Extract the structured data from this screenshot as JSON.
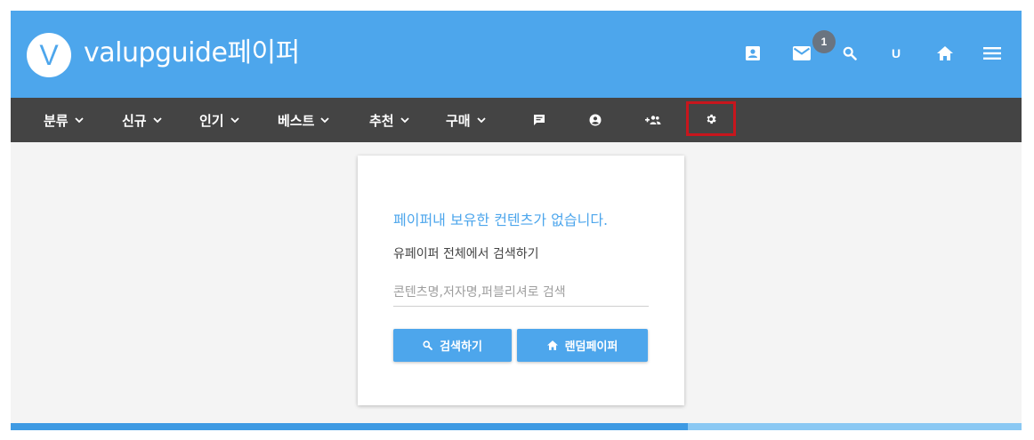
{
  "header": {
    "logo_letter": "V",
    "brand": "valupguide페이퍼",
    "mail_badge": "1",
    "user_initial": "U",
    "icons": [
      "contact-icon",
      "mail-icon",
      "search-icon",
      "user-icon",
      "home-icon",
      "menu-icon"
    ]
  },
  "nav": {
    "items": [
      {
        "label": "분류"
      },
      {
        "label": "신규"
      },
      {
        "label": "인기"
      },
      {
        "label": "베스트"
      },
      {
        "label": "추천"
      },
      {
        "label": "구매"
      }
    ],
    "icons": [
      "message-icon",
      "account-icon",
      "group-add-icon",
      "gear-icon"
    ],
    "highlight_color": "#c8161d"
  },
  "card": {
    "message": "페이퍼내 보유한 컨텐츠가 없습니다.",
    "subtitle": "유페이퍼 전체에서 검색하기",
    "search_placeholder": "콘텐츠명,저자명,퍼블리셔로 검색",
    "search_value": "",
    "search_button": "검색하기",
    "random_button": "랜덤페이퍼"
  },
  "progress": {
    "value": 0.67
  },
  "colors": {
    "header": "#4da6ec",
    "nav": "#444444",
    "accent": "#4da6ec",
    "background": "#f4f4f4"
  }
}
